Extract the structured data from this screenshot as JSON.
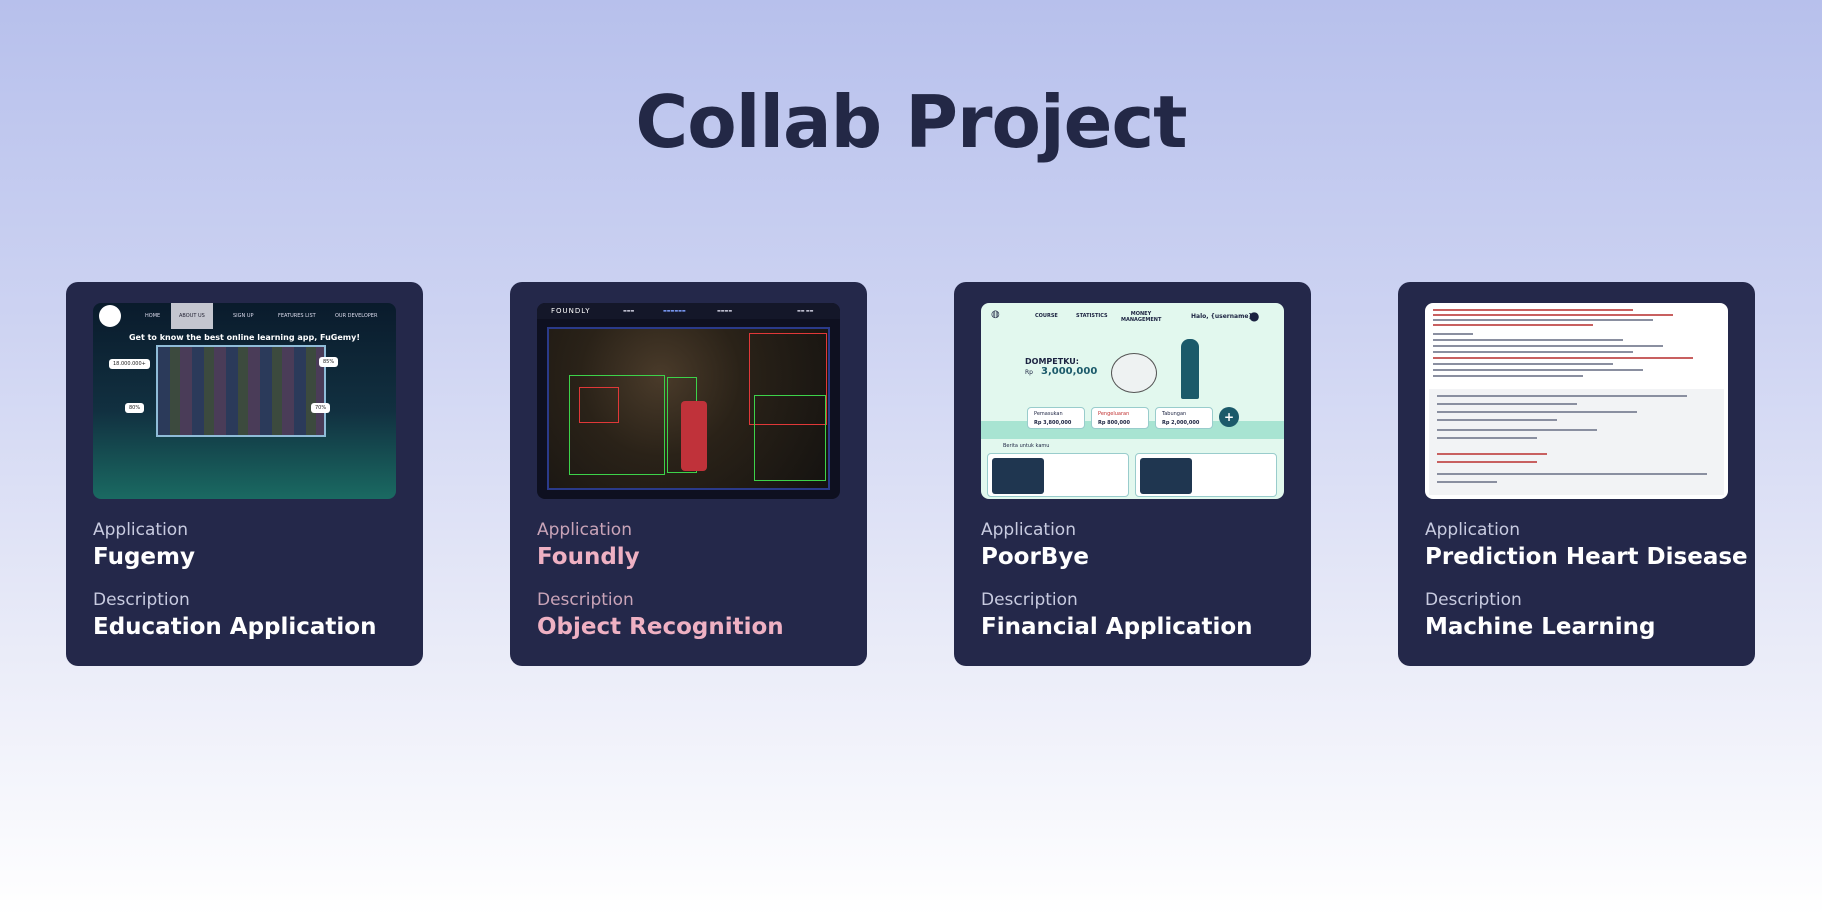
{
  "page": {
    "title": "Collab Project"
  },
  "projects": [
    {
      "application_label": "Application",
      "name": "Fugemy",
      "description_label": "Description",
      "description": "Education Application",
      "screenshot": {
        "headline": "Get to know the best online learning app, FuGemy!",
        "nav": [
          "HOME",
          "ABOUT US",
          "SIGN UP",
          "FEATURES LIST",
          "OUR DEVELOPER"
        ],
        "stats": [
          "18.000.000+",
          "85%",
          "80%",
          "70%"
        ]
      }
    },
    {
      "application_label": "Application",
      "name": "Foundly",
      "description_label": "Description",
      "description": "Object Recognition",
      "highlighted": true,
      "screenshot": {
        "brand": "FOUNDLY"
      }
    },
    {
      "application_label": "Application",
      "name": "PoorBye",
      "description_label": "Description",
      "description": "Financial Application",
      "screenshot": {
        "nav": [
          "COURSE",
          "STATISTICS",
          "MONEY MANAGEMENT"
        ],
        "greeting": "Halo, {username}!",
        "wallet_label": "DOMPETKU:",
        "wallet_currency": "Rp",
        "wallet_amount": "3,000,000",
        "pills": [
          {
            "label": "Pemasukan",
            "amount": "Rp 3,800,000"
          },
          {
            "label": "Pengeluaran",
            "amount": "Rp 800,000"
          },
          {
            "label": "Tabungan",
            "amount": "Rp 2,000,000"
          }
        ],
        "section": "Berita untuk kamu"
      }
    },
    {
      "application_label": "Application",
      "name": "Prediction Heart Disease",
      "description_label": "Description",
      "description": "Machine Learning"
    }
  ],
  "colors": {
    "card_bg": "#24284a",
    "title": "#232846",
    "highlight_text": "#efb1c3"
  }
}
